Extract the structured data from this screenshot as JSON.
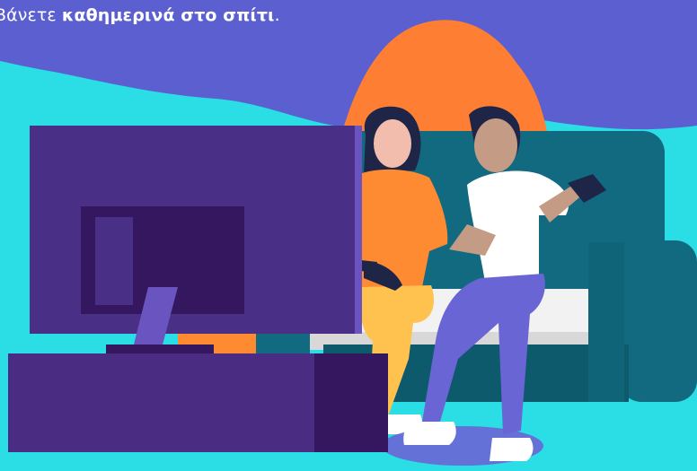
{
  "caption": {
    "prefix": "Βάνετε ",
    "emphasis": "καθημερινά στο σπίτι",
    "suffix": "."
  },
  "colors": {
    "background_top": "#5b5fcf",
    "background_bottom": "#2bdde4",
    "blob": "#fe7f33",
    "sofa": "#126a80",
    "sofa_dark": "#0e5a6d",
    "tv_frame": "#4a2f86",
    "tv_screen": "#35175f",
    "cabinet": "#4b2c83",
    "shirt_orange": "#fe8a32",
    "pants_yellow": "#ffc24e",
    "shirt_white": "#ffffff",
    "pants_purple": "#6a65d4",
    "skin": "#f3bdae",
    "skin_dark": "#c49b84",
    "hair": "#1f2547"
  },
  "icons": {
    "controller_left": "gamepad-icon",
    "controller_right": "gamepad-icon"
  }
}
